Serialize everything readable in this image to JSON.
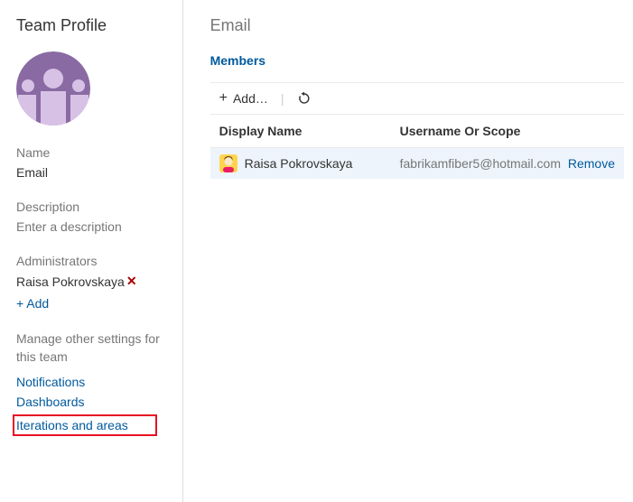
{
  "sidebar": {
    "title": "Team Profile",
    "name_label": "Name",
    "name_value": "Email",
    "description_label": "Description",
    "description_placeholder": "Enter a description",
    "administrators_label": "Administrators",
    "administrators": [
      {
        "name": "Raisa Pokrovskaya"
      }
    ],
    "add_label": "+ Add",
    "settings_heading": "Manage other settings for this team",
    "links": {
      "notifications": "Notifications",
      "dashboards": "Dashboards",
      "iterations": "Iterations and areas"
    }
  },
  "main": {
    "title": "Email",
    "tab_members": "Members",
    "toolbar": {
      "add_label": "Add…"
    },
    "columns": {
      "display_name": "Display Name",
      "username": "Username Or Scope"
    },
    "members": [
      {
        "display_name": "Raisa Pokrovskaya",
        "username": "fabrikamfiber5@hotmail.com",
        "remove_label": "Remove"
      }
    ]
  }
}
